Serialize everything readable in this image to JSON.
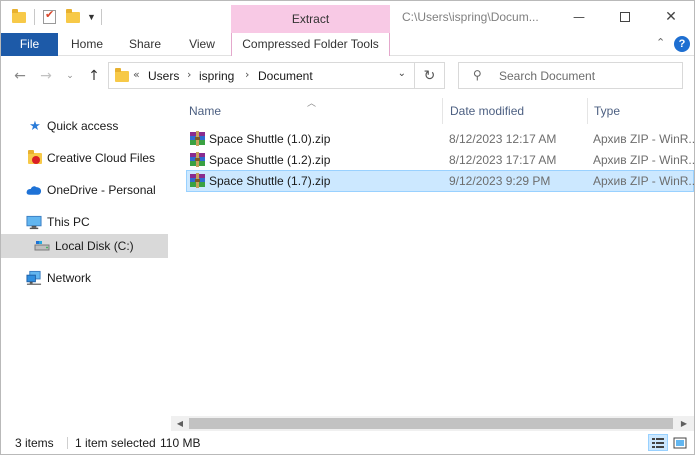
{
  "window": {
    "path_title": "C:\\Users\\ispring\\Docum...",
    "context_group": "Extract",
    "controls": {
      "minimize": "—",
      "maximize": "☐",
      "close": "✕"
    }
  },
  "ribbon": {
    "tabs": [
      {
        "label": "File"
      },
      {
        "label": "Home"
      },
      {
        "label": "Share"
      },
      {
        "label": "View"
      },
      {
        "label": "Compressed Folder Tools"
      }
    ],
    "collapse_icon": "chevron-up-icon",
    "help_icon": "help-icon"
  },
  "address": {
    "overflow": "«",
    "crumbs": [
      "Users",
      "ispring",
      "Document"
    ]
  },
  "search": {
    "placeholder": "Search Document"
  },
  "nav": {
    "items": [
      {
        "label": "Quick access",
        "icon": "star-icon"
      },
      {
        "label": "Creative Cloud Files",
        "icon": "creative-cloud-folder-icon"
      },
      {
        "label": "OneDrive - Personal",
        "icon": "cloud-icon"
      },
      {
        "label": "This PC",
        "icon": "computer-icon"
      },
      {
        "label": "Local Disk (C:)",
        "icon": "drive-icon"
      },
      {
        "label": "Network",
        "icon": "network-icon"
      }
    ]
  },
  "columns": {
    "name": "Name",
    "date": "Date modified",
    "type": "Type"
  },
  "files": [
    {
      "name": "Space Shuttle (1.0).zip",
      "date": "8/12/2023 12:17 AM",
      "type": "Архив ZIP - WinR...",
      "selected": false
    },
    {
      "name": "Space Shuttle (1.2).zip",
      "date": "8/12/2023 17:17 AM",
      "type": "Архив ZIP - WinR...",
      "selected": false
    },
    {
      "name": "Space Shuttle (1.7).zip",
      "date": "9/12/2023 9:29 PM",
      "type": "Архив ZIP - WinR...",
      "selected": true
    }
  ],
  "status": {
    "count": "3 items",
    "selection": "1 item selected",
    "size": "110 MB"
  },
  "colors": {
    "file_tab": "#1d5aa8",
    "context_tab": "#f8c9e5",
    "selection": "#cce8ff",
    "selection_border": "#99d1ff",
    "column_header": "#4d6082"
  }
}
